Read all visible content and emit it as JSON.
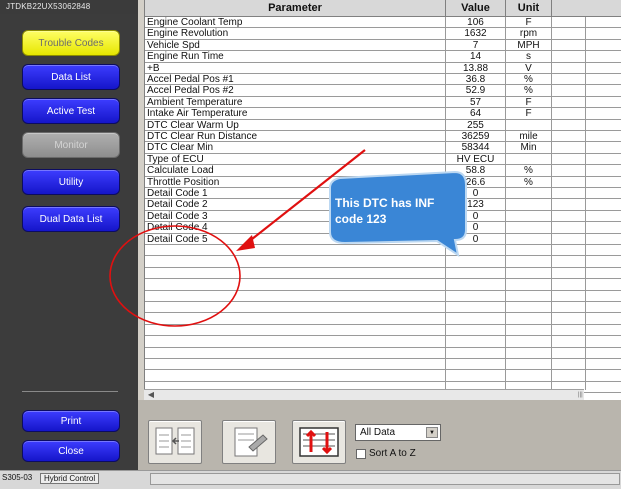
{
  "vin": "JTDKB22UX53062848",
  "sidebar": {
    "items": [
      {
        "label": "Trouble Codes"
      },
      {
        "label": "Data List"
      },
      {
        "label": "Active Test"
      },
      {
        "label": "Monitor"
      },
      {
        "label": "Utility"
      },
      {
        "label": "Dual Data List"
      }
    ],
    "print_label": "Print",
    "close_label": "Close"
  },
  "table": {
    "headers": [
      "Parameter",
      "Value",
      "Unit"
    ],
    "rows": [
      [
        "Engine Coolant Temp",
        "106",
        "F"
      ],
      [
        "Engine Revolution",
        "1632",
        "rpm"
      ],
      [
        "Vehicle Spd",
        "7",
        "MPH"
      ],
      [
        "Engine Run Time",
        "14",
        "s"
      ],
      [
        "+B",
        "13.88",
        "V"
      ],
      [
        "Accel Pedal Pos #1",
        "36.8",
        "%"
      ],
      [
        "Accel Pedal Pos #2",
        "52.9",
        "%"
      ],
      [
        "Ambient Temperature",
        "57",
        "F"
      ],
      [
        "Intake Air Temperature",
        "64",
        "F"
      ],
      [
        "DTC Clear Warm Up",
        "255",
        ""
      ],
      [
        "DTC Clear Run Distance",
        "36259",
        "mile"
      ],
      [
        "DTC Clear Min",
        "58344",
        "Min"
      ],
      [
        "Type of ECU",
        "HV ECU",
        ""
      ],
      [
        "Calculate Load",
        "58.8",
        "%"
      ],
      [
        "Throttle Position",
        "26.6",
        "%"
      ],
      [
        "Detail Code 1",
        "0",
        ""
      ],
      [
        "Detail Code 2",
        "123",
        ""
      ],
      [
        "Detail Code 3",
        "0",
        ""
      ],
      [
        "Detail Code 4",
        "0",
        ""
      ],
      [
        "Detail Code 5",
        "0",
        ""
      ],
      [
        "",
        "",
        ""
      ],
      [
        "",
        "",
        ""
      ],
      [
        "",
        "",
        ""
      ],
      [
        "",
        "",
        ""
      ],
      [
        "",
        "",
        ""
      ],
      [
        "",
        "",
        ""
      ],
      [
        "",
        "",
        ""
      ],
      [
        "",
        "",
        ""
      ],
      [
        "",
        "",
        ""
      ],
      [
        "",
        "",
        ""
      ],
      [
        "",
        "",
        ""
      ],
      [
        "",
        "",
        ""
      ],
      [
        "",
        "",
        ""
      ]
    ]
  },
  "toolbar": {
    "filter_value": "All Data",
    "sort_label": "Sort A to Z"
  },
  "callout": {
    "text": "This DTC has INF code 123"
  },
  "status": {
    "code": "S305-03",
    "module": "Hybrid Control"
  },
  "colors": {
    "accent_blue": "#1515c9",
    "highlight_yellow": "#ffff33",
    "annotation_red": "#e01010",
    "callout_blue": "#3a86d6"
  }
}
